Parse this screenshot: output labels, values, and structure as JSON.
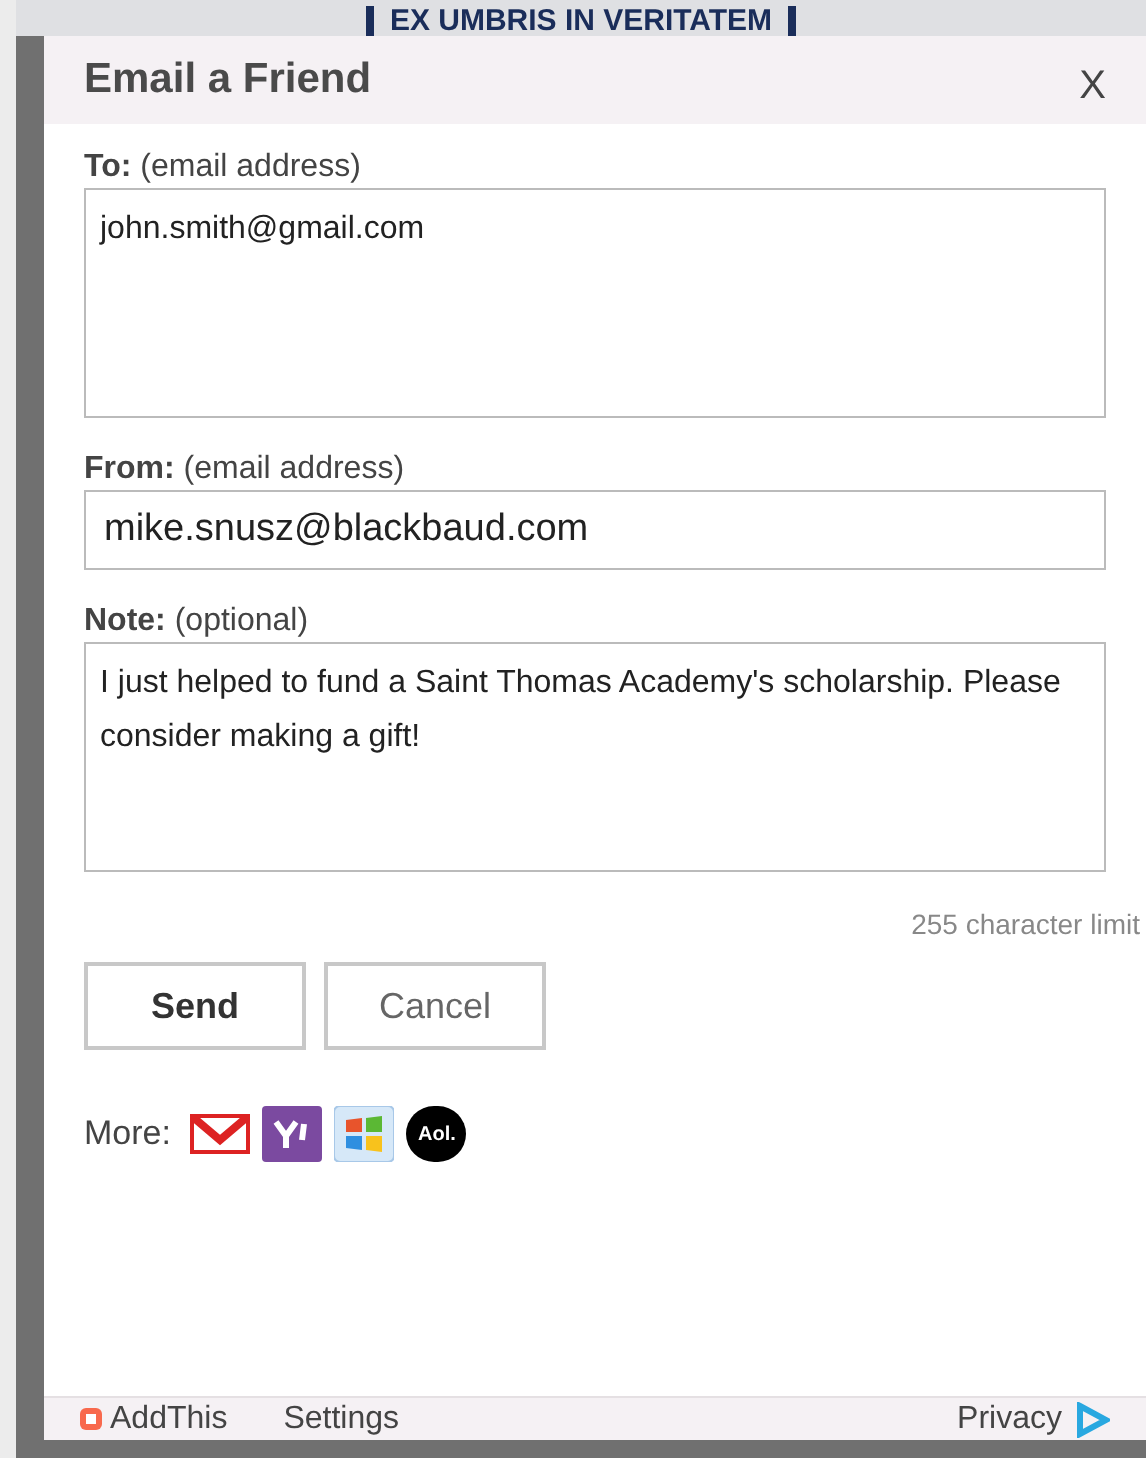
{
  "background": {
    "motto": "EX UMBRIS IN VERITATEM"
  },
  "dialog": {
    "title": "Email a Friend",
    "close": "X"
  },
  "fields": [
    {
      "kind": "textarea",
      "label": "To:",
      "hint": "(email address)",
      "value": "john.smith@gmail.com"
    },
    {
      "kind": "input",
      "label": "From:",
      "hint": "(email address)",
      "value": "mike.snusz@blackbaud.com"
    },
    {
      "kind": "textarea",
      "label": "Note:",
      "hint": "(optional)",
      "value": "I just helped to fund a Saint Thomas Academy's scholarship. Please consider making a gift!"
    }
  ],
  "char_limit": "255 character limit",
  "buttons": [
    {
      "label": "Send",
      "kind": "primary"
    },
    {
      "label": "Cancel",
      "kind": "secondary"
    }
  ],
  "more": {
    "label": "More:",
    "services": [
      {
        "kind": "gmail"
      },
      {
        "kind": "yahoo"
      },
      {
        "kind": "windows"
      },
      {
        "kind": "aol",
        "text": "Aol."
      }
    ]
  },
  "footer": {
    "brand": "AddThis",
    "settings": "Settings",
    "privacy": "Privacy"
  }
}
